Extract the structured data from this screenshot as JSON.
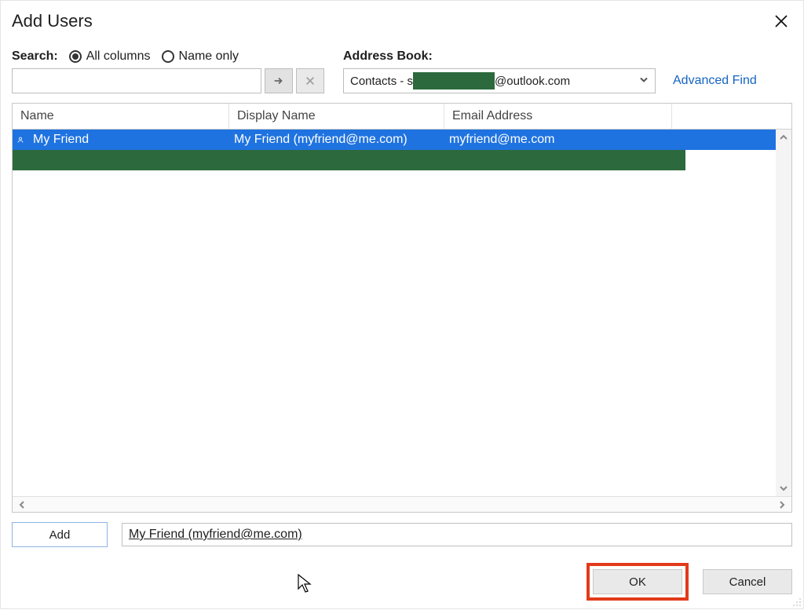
{
  "dialog": {
    "title": "Add Users"
  },
  "search": {
    "label": "Search:",
    "option_all": "All columns",
    "option_name": "Name only",
    "value": ""
  },
  "address_book": {
    "label": "Address Book:",
    "selected_prefix": "Contacts - s",
    "selected_suffix": "@outlook.com",
    "advanced_find": "Advanced Find"
  },
  "columns": {
    "name": "Name",
    "display": "Display Name",
    "email": "Email Address"
  },
  "rows": [
    {
      "name": "My Friend",
      "display": "My Friend (myfriend@me.com)",
      "email": "myfriend@me.com",
      "selected": true
    }
  ],
  "add": {
    "button": "Add",
    "recipients": "My Friend (myfriend@me.com)"
  },
  "buttons": {
    "ok": "OK",
    "cancel": "Cancel"
  }
}
